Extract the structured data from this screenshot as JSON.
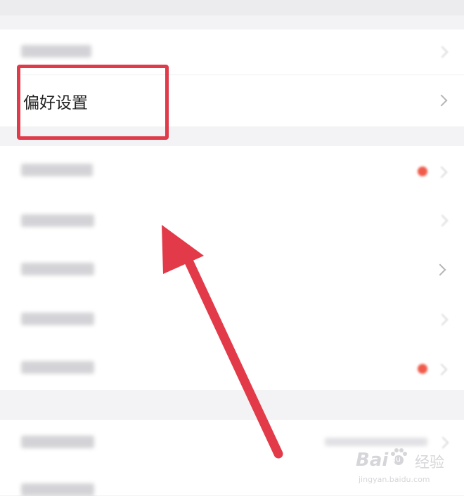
{
  "settings": {
    "preference_row": {
      "label": "偏好设置"
    }
  },
  "watermark": {
    "brand": "Bai",
    "brand_tail": "du",
    "sub": "经验",
    "url": "jingyan.baidu.com"
  },
  "colors": {
    "highlight": "#e03b4a",
    "arrow": "#e23a48",
    "badge": "#f05a4a"
  },
  "icons": [
    "chevron-right-icon",
    "red-dot-badge-icon",
    "arrow-annotation-icon",
    "paw-icon"
  ]
}
